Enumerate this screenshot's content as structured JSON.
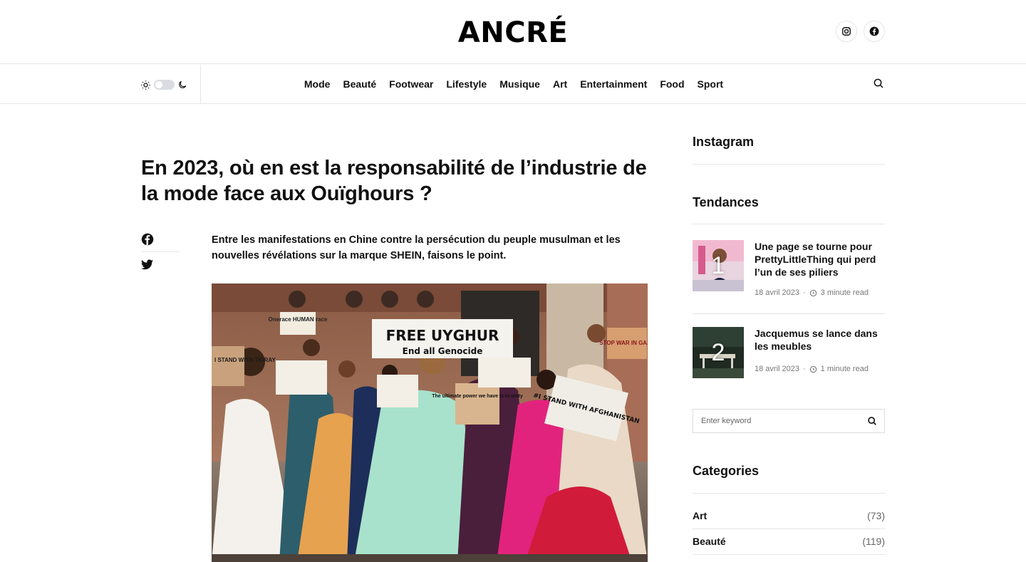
{
  "header": {
    "logo": "ANCRÉ",
    "social": [
      {
        "icon": "instagram-icon"
      },
      {
        "icon": "facebook-icon"
      }
    ]
  },
  "nav": {
    "items": [
      "Mode",
      "Beauté",
      "Footwear",
      "Lifestyle",
      "Musique",
      "Art",
      "Entertainment",
      "Food",
      "Sport"
    ]
  },
  "article": {
    "title": "En 2023, où en est la responsabilité de l’industrie de la mode face aux Ouïghours ?",
    "lead": "Entre les manifestations en Chine contre la persécution du peuple musulman et les nouvelles révélations sur la marque SHEIN, faisons le point.",
    "image": {
      "signs": [
        "Onerace HUMAN race",
        "FREE UYGHUR",
        "End all Genocide",
        "I STAND WITH TIGRAY",
        "STOP WAR IN GAZA",
        "#I STAND WITH AFGHANISTAN",
        "The ultimate power we have is in unity"
      ]
    }
  },
  "sidebar": {
    "instagram_title": "Instagram",
    "trends_title": "Tendances",
    "trends": [
      {
        "num": "1",
        "title": "Une page se tourne pour PrettyLittleThing qui perd l’un de ses piliers",
        "date": "18 avril 2023",
        "read": "3 minute read"
      },
      {
        "num": "2",
        "title": "Jacquemus se lance dans les meubles",
        "date": "18 avril 2023",
        "read": "1 minute read"
      }
    ],
    "search_placeholder": "Enter keyword",
    "categories_title": "Categories",
    "categories": [
      {
        "name": "Art",
        "count": "(73)"
      },
      {
        "name": "Beauté",
        "count": "(119)"
      }
    ]
  },
  "colors": {
    "text": "#111111",
    "muted": "#777777",
    "border": "#e6e6e6"
  }
}
